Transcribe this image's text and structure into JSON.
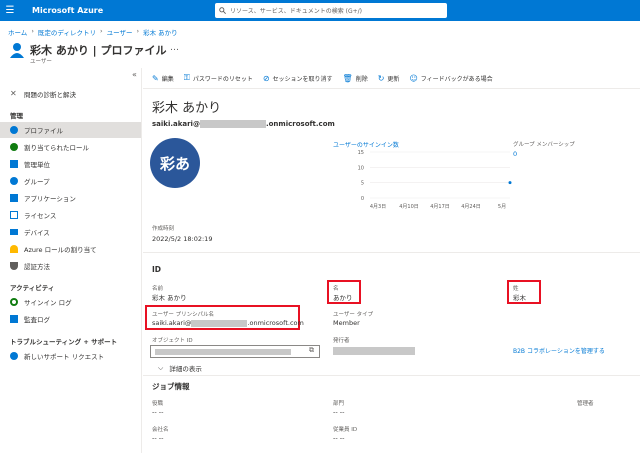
{
  "topbar": {
    "brand": "Microsoft Azure",
    "search_placeholder": "リソース、サービス、ドキュメントの検索 (G+/)"
  },
  "breadcrumb": [
    "ホーム",
    "既定のディレクトリ",
    "ユーザー",
    "彩木 あかり"
  ],
  "page": {
    "title": "彩木 あかり | プロファイル",
    "subtitle": "ユーザー",
    "more": "…"
  },
  "sidebar": {
    "collapse": "«",
    "items": [
      {
        "label": "問題の診断と解決"
      },
      {
        "label": "プロファイル"
      },
      {
        "label": "割り当てられたロール"
      },
      {
        "label": "管理単位"
      },
      {
        "label": "グループ"
      },
      {
        "label": "アプリケーション"
      },
      {
        "label": "ライセンス"
      },
      {
        "label": "デバイス"
      },
      {
        "label": "Azure ロールの割り当て"
      },
      {
        "label": "認証方法"
      },
      {
        "label": "サインイン ログ"
      },
      {
        "label": "監査ログ"
      },
      {
        "label": "新しいサポート リクエスト"
      }
    ],
    "headers": [
      "管理",
      "アクティビティ",
      "トラブルシューティング + サポート"
    ]
  },
  "toolbar": [
    "編集",
    "パスワードのリセット",
    "セッションを取り消す",
    "削除",
    "更新",
    "フィードバックがある場合"
  ],
  "user": {
    "display_name": "彩木 あかり",
    "email_prefix": "saiki.akari@",
    "email_suffix": ".onmicrosoft.com",
    "avatar": "彩あ",
    "created_label": "作成時刻",
    "created_value": "2022/5/2 18:02:19"
  },
  "signin_chart": {
    "title": "ユーザーのサインイン数",
    "group_label": "グループ メンバーシップ",
    "group_value": "0"
  },
  "chart_data": {
    "type": "scatter",
    "categories": [
      "4月3日",
      "4月10日",
      "4月17日",
      "4月24日",
      "5月"
    ],
    "y_ticks": [
      "15",
      "10",
      "5",
      "0"
    ],
    "ylim": [
      0,
      15
    ],
    "points": [
      {
        "x": "5月",
        "y": 5
      }
    ]
  },
  "id_section": {
    "title": "ID",
    "name_label": "名前",
    "name_value": "彩木 あかり",
    "given_label": "名",
    "given_value": "あかり",
    "surname_label": "姓",
    "surname_value": "彩木",
    "upn_label": "ユーザー プリンシパル名",
    "upn_prefix": "saiki.akari@",
    "upn_suffix": ".onmicrosoft.com",
    "type_label": "ユーザー タイプ",
    "type_value": "Member",
    "objid_label": "オブジェクト ID",
    "issuer_label": "発行者",
    "b2b_link": "B2B コラボレーションを管理する",
    "details": "詳細の表示"
  },
  "job": {
    "title": "ジョブ情報",
    "role_label": "役職",
    "role_value": "-- --",
    "dept_label": "部門",
    "dept_value": "-- --",
    "manager_label": "管理者",
    "company_label": "会社名",
    "company_value": "-- --",
    "empid_label": "従業員 ID",
    "empid_value": "-- --"
  },
  "colors": {
    "accent": "#0078d4",
    "avatar": "#2b579a",
    "highlight": "#e81123"
  }
}
